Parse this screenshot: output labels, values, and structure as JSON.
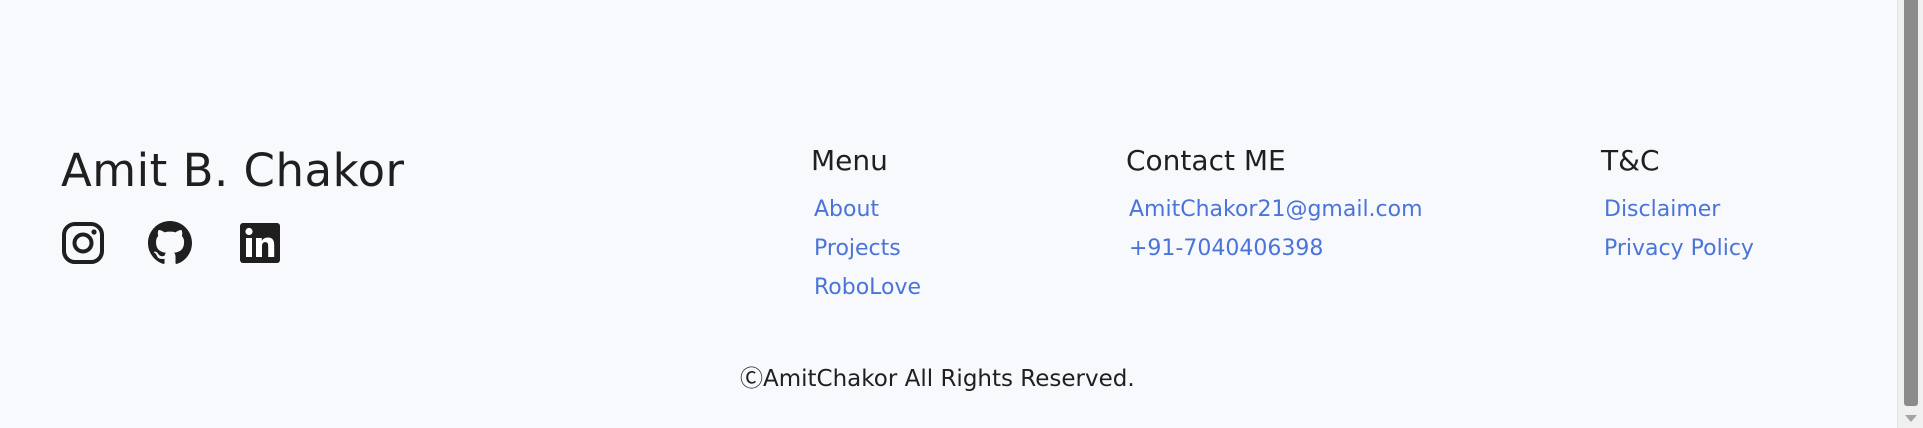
{
  "brand": {
    "name": "Amit B. Chakor"
  },
  "social": [
    {
      "icon": "instagram-icon"
    },
    {
      "icon": "github-icon"
    },
    {
      "icon": "linkedin-icon"
    }
  ],
  "columns": {
    "menu": {
      "heading": "Menu",
      "links": [
        "About",
        "Projects",
        "RoboLove"
      ]
    },
    "contact": {
      "heading": "Contact ME",
      "links": [
        "AmitChakor21@gmail.com",
        "+91-7040406398"
      ]
    },
    "terms": {
      "heading": "T&C",
      "links": [
        "Disclaimer",
        "Privacy Policy"
      ]
    }
  },
  "copyright": "ⒸAmitChakor All Rights Reserved.",
  "colors": {
    "background": "#f8f9fc",
    "text": "#1f1f1f",
    "link": "#4a74d9"
  }
}
